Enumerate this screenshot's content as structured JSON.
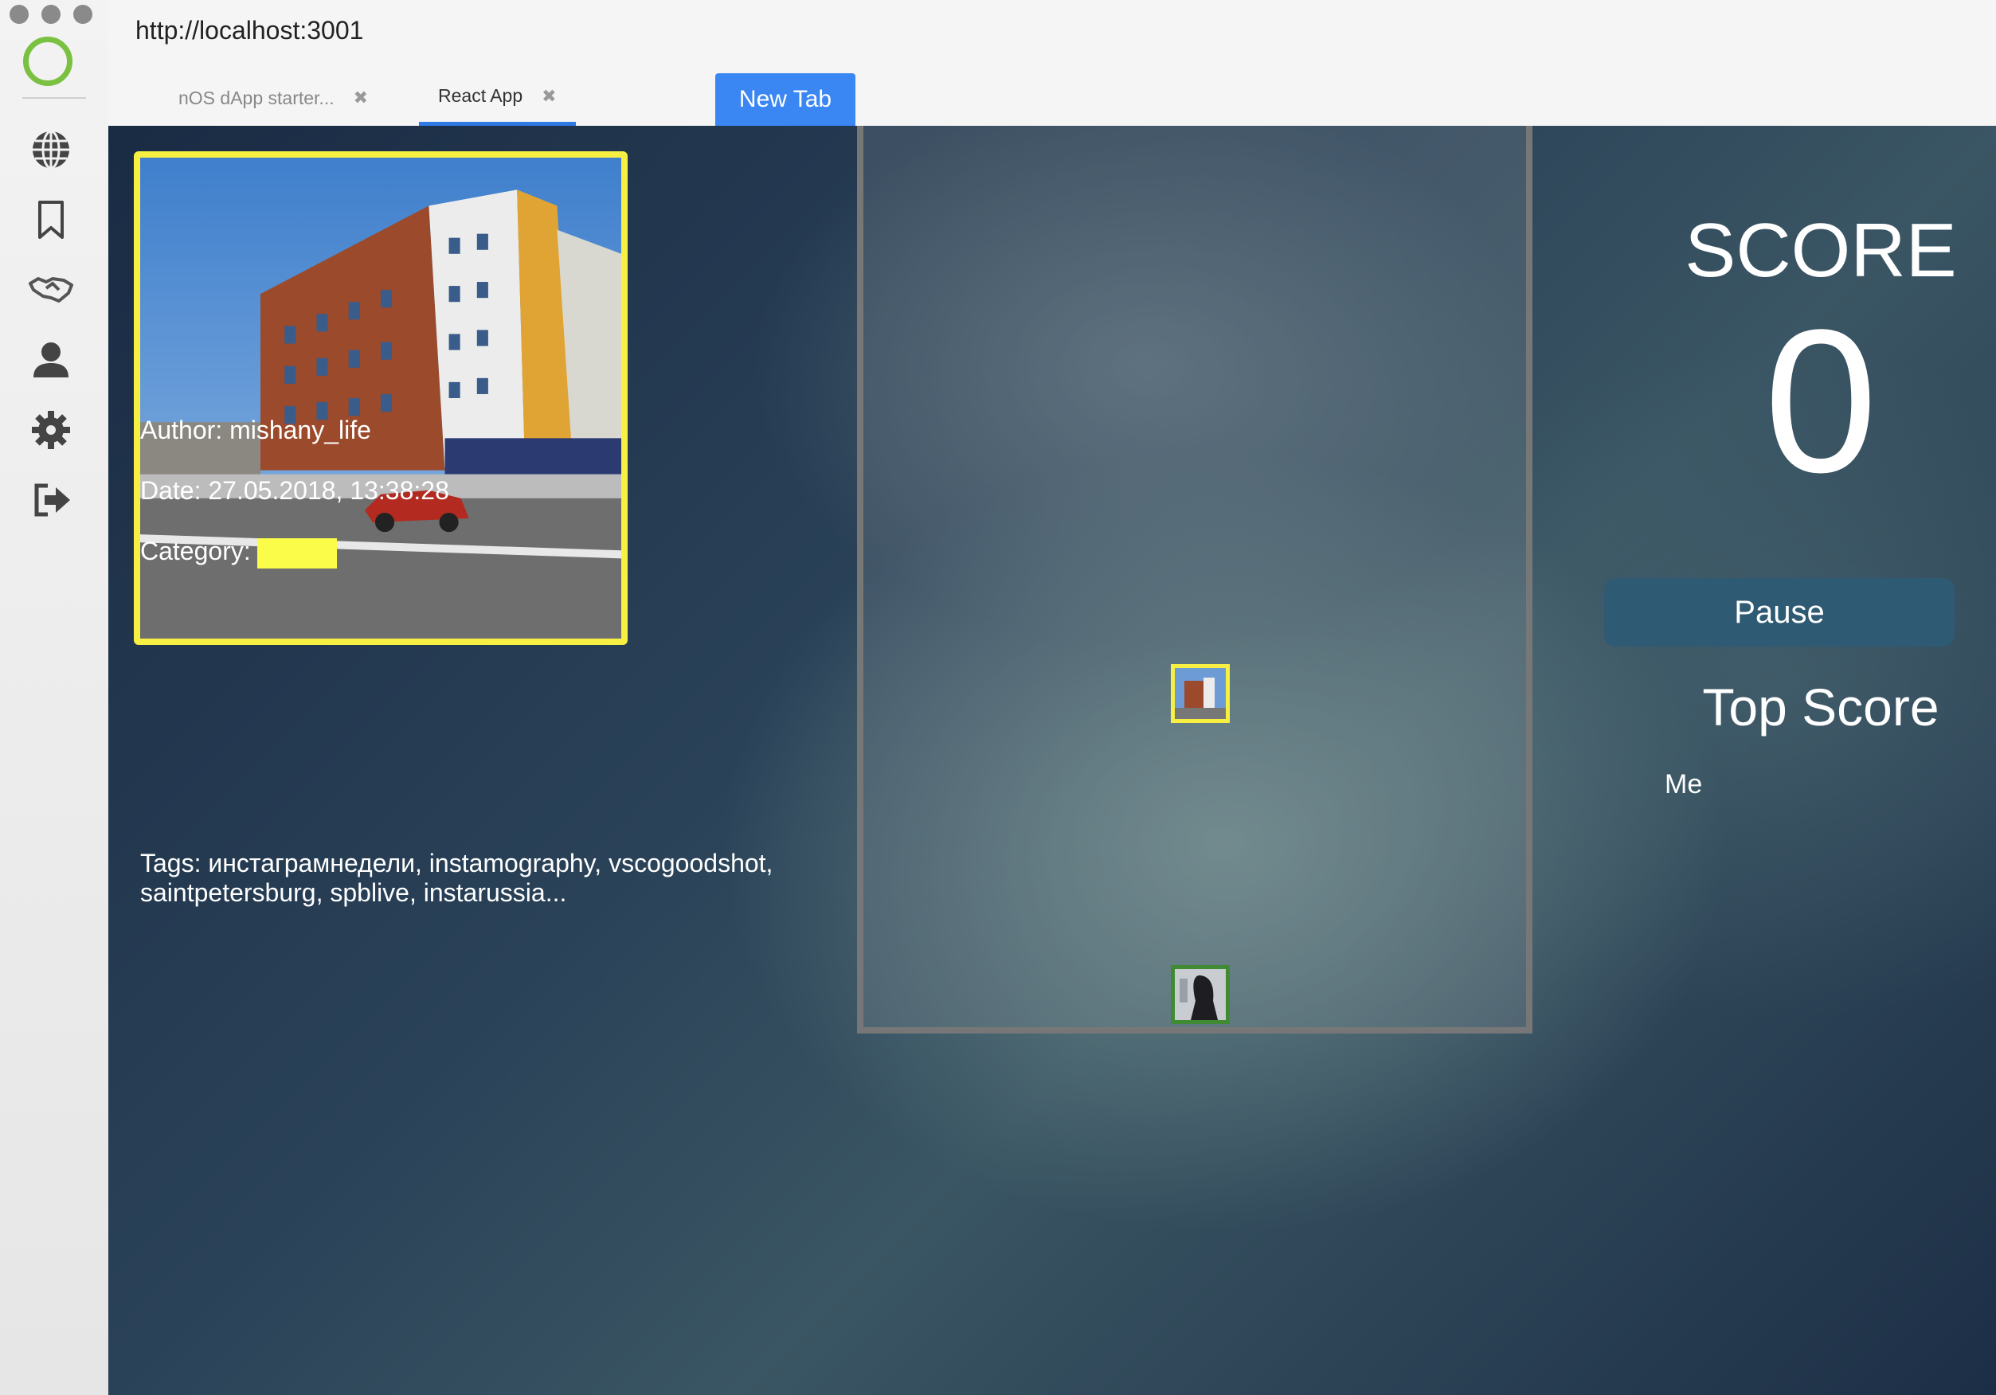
{
  "browser": {
    "url": "http://localhost:3001",
    "tabs": [
      {
        "label": "nOS dApp starter...",
        "active": false
      },
      {
        "label": "React App",
        "active": true
      }
    ],
    "new_tab_label": "New Tab",
    "accent": "#3a86f2"
  },
  "sidebar": {
    "logo_color": "#7ac142",
    "items": [
      {
        "icon": "globe-icon"
      },
      {
        "icon": "bookmark-icon"
      },
      {
        "icon": "handshake-icon"
      },
      {
        "icon": "user-icon"
      },
      {
        "icon": "gear-icon"
      },
      {
        "icon": "logout-icon"
      }
    ]
  },
  "photo": {
    "author": "Author: mishany_life",
    "date": "Date: 27.05.2018, 13:38:28",
    "category_label": "Category:",
    "category_color": "#fbfb4a",
    "tags_line1": "Tags: инстаграмнедели, instamography, vscogoodshot,",
    "tags_line2": "saintpetersburg, spblive, instarussia..."
  },
  "game": {
    "score_title": "SCORE",
    "score": "0",
    "pause_label": "Pause",
    "top_score_title": "Top Score",
    "top_score_entries": [
      "Me"
    ]
  }
}
